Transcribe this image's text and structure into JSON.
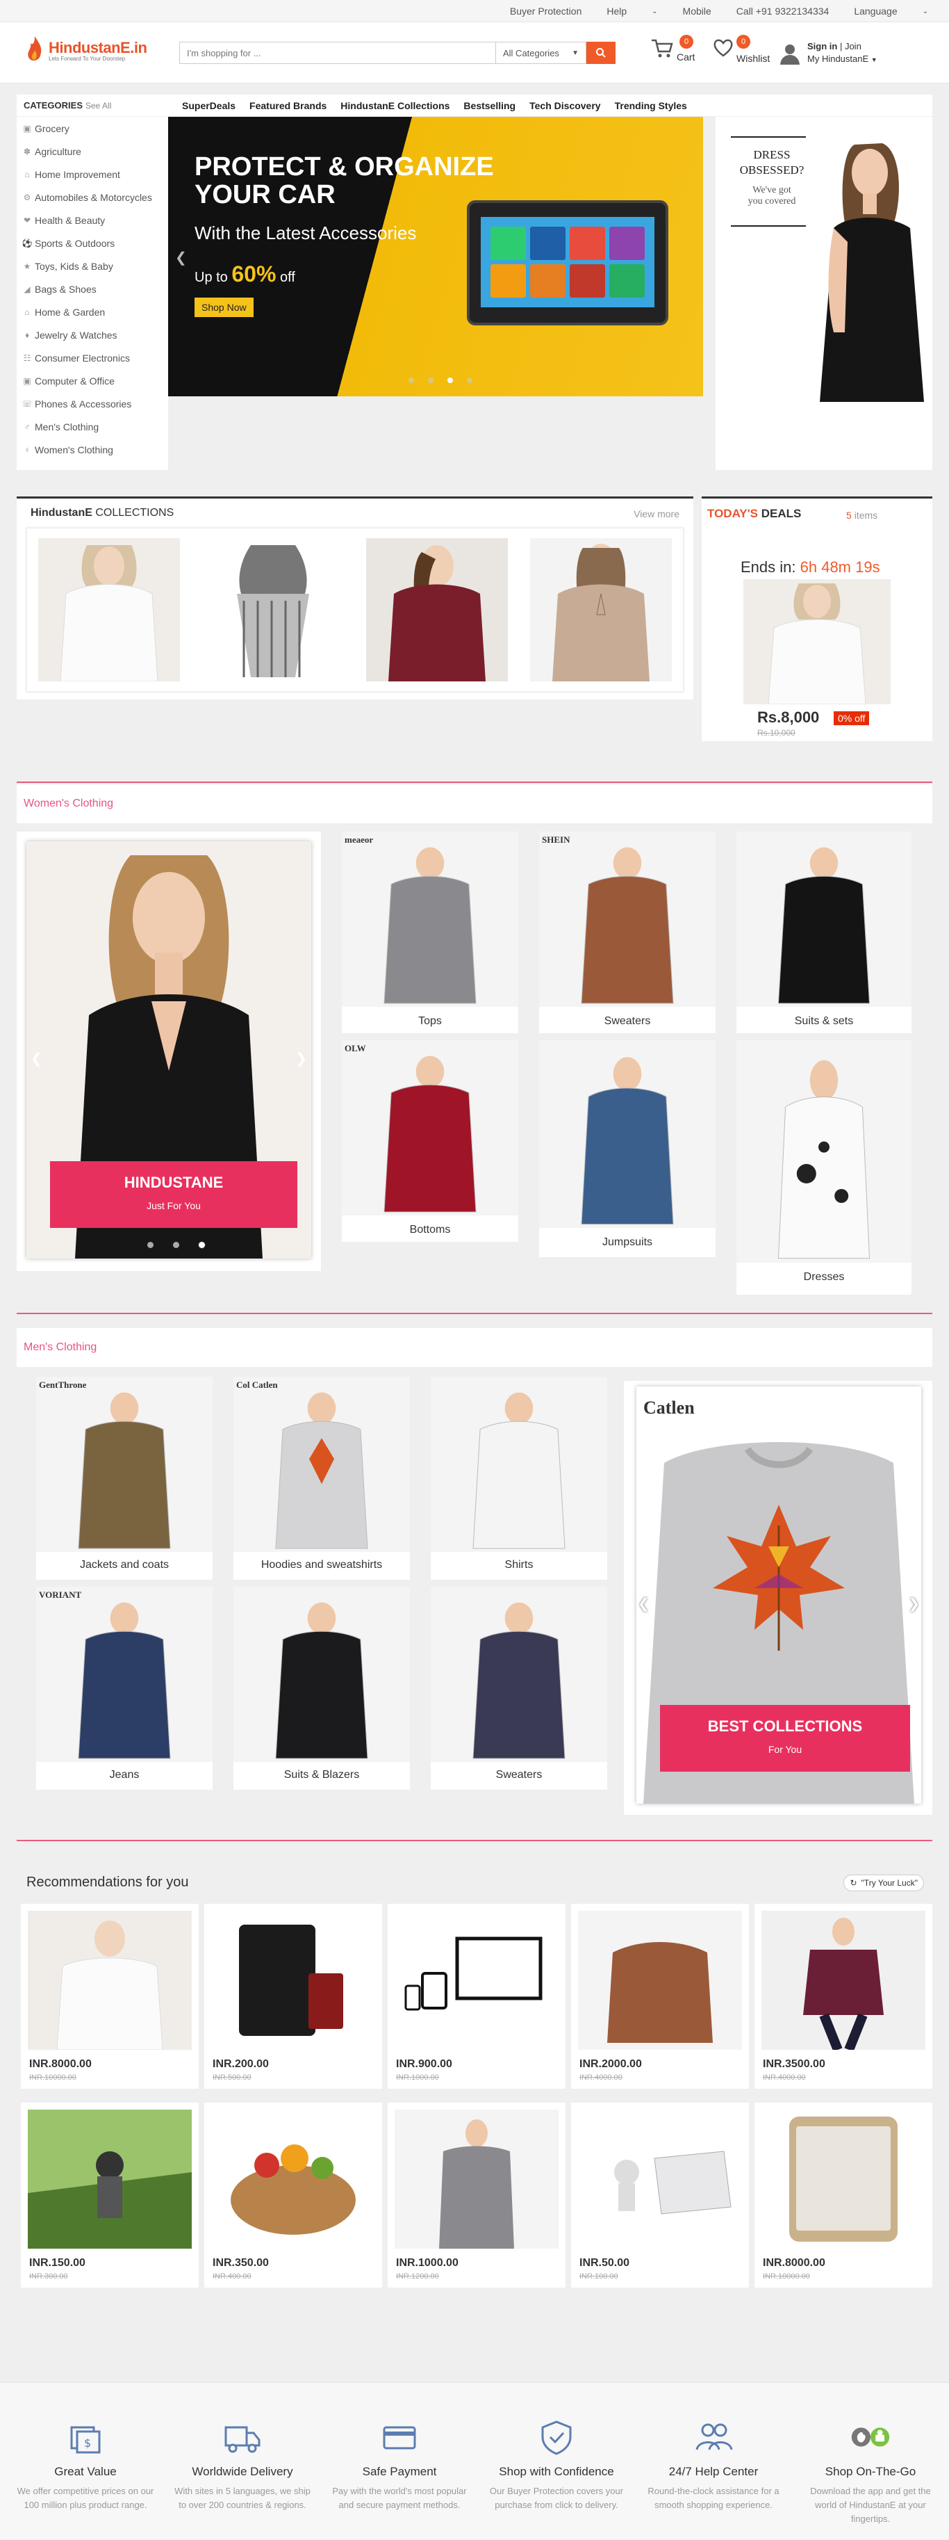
{
  "topbar": {
    "buyer_protection": "Buyer Protection",
    "help": "Help",
    "mobile": "Mobile",
    "call": "Call +91 9322134334",
    "language": "Language"
  },
  "header": {
    "logo_name": "HindustanE.in",
    "logo_tagline": "Lets Forward To Your Doorstep",
    "search_placeholder": "I'm shopping for ...",
    "search_category": "All Categories",
    "cart_label": "Cart",
    "cart_count": "0",
    "wishlist_label": "Wishlist",
    "wishlist_count": "0",
    "sign_in": "Sign in",
    "join": "Join",
    "my_account": "My HindustanE"
  },
  "categories": {
    "title": "CATEGORIES",
    "see_all": "See All",
    "items": [
      {
        "label": "Grocery"
      },
      {
        "label": "Agriculture"
      },
      {
        "label": "Home Improvement"
      },
      {
        "label": "Automobiles & Motorcycles"
      },
      {
        "label": "Health & Beauty"
      },
      {
        "label": "Sports & Outdoors"
      },
      {
        "label": "Toys, Kids & Baby"
      },
      {
        "label": "Bags & Shoes"
      },
      {
        "label": "Home & Garden"
      },
      {
        "label": "Jewelry & Watches"
      },
      {
        "label": "Consumer Electronics"
      },
      {
        "label": "Computer & Office"
      },
      {
        "label": "Phones & Accessories"
      },
      {
        "label": "Men's Clothing"
      },
      {
        "label": "Women's Clothing"
      }
    ]
  },
  "nav": {
    "items": [
      {
        "label": "SuperDeals"
      },
      {
        "label": "Featured Brands"
      },
      {
        "label": "HindustanE Collections"
      },
      {
        "label": "Bestselling"
      },
      {
        "label": "Tech Discovery"
      },
      {
        "label": "Trending Styles"
      }
    ]
  },
  "hero": {
    "line1": "PROTECT & ORGANIZE",
    "line2": "YOUR CAR",
    "line3": "With the Latest Accessories",
    "upto": "Up to",
    "percent": "60%",
    "off": "off",
    "shop_now": "Shop Now",
    "active_dot": 3
  },
  "side_ad": {
    "line1": "DRESS",
    "line2": "OBSESSED?",
    "line3": "We've got",
    "line4": "you covered"
  },
  "collections": {
    "brand": "HindustanE",
    "title": "COLLECTIONS",
    "view_more": "View more"
  },
  "deals": {
    "todays": "TODAY'S",
    "deals": "DEALS",
    "count": "5",
    "items_label": "items",
    "ends_in": "Ends in:",
    "timer": "6h 48m 19s",
    "price": "Rs.8,000",
    "off": "0% off",
    "old_price": "Rs.10,000"
  },
  "women": {
    "title": "Women's Clothing",
    "banner_title": "HINDUSTANE",
    "banner_sub": "Just For You",
    "tiles": [
      {
        "label": "Tops",
        "brand": "meaeor"
      },
      {
        "label": "Sweaters",
        "brand": "SHEIN"
      },
      {
        "label": "Suits & sets",
        "brand": ""
      },
      {
        "label": "Bottoms",
        "brand": "OLW"
      },
      {
        "label": "Jumpsuits",
        "brand": ""
      },
      {
        "label": "Dresses",
        "brand": ""
      }
    ]
  },
  "men": {
    "title": "Men's Clothing",
    "banner_title": "BEST COLLECTIONS",
    "banner_sub": "For You",
    "carousel_brand": "Catlen",
    "tiles": [
      {
        "label": "Jackets and coats",
        "brand": "GentThrone"
      },
      {
        "label": "Hoodies and sweatshirts",
        "brand": "Col Catlen"
      },
      {
        "label": "Shirts",
        "brand": ""
      },
      {
        "label": "Jeans",
        "brand": "VORIANT"
      },
      {
        "label": "Suits & Blazers",
        "brand": ""
      },
      {
        "label": "Sweaters",
        "brand": ""
      }
    ]
  },
  "recommendations": {
    "title": "Recommendations for you",
    "luck": "\"Try Your Luck\"",
    "items": [
      {
        "price": "INR.8000.00",
        "old": "INR.10000.00"
      },
      {
        "price": "INR.200.00",
        "old": "INR.500.00"
      },
      {
        "price": "INR.900.00",
        "old": "INR.1000.00"
      },
      {
        "price": "INR.2000.00",
        "old": "INR.4000.00"
      },
      {
        "price": "INR.3500.00",
        "old": "INR.4000.00"
      },
      {
        "price": "INR.150.00",
        "old": "INR.300.00"
      },
      {
        "price": "INR.350.00",
        "old": "INR.400.00"
      },
      {
        "price": "INR.1000.00",
        "old": "INR.1200.00"
      },
      {
        "price": "INR.50.00",
        "old": "INR.100.00"
      },
      {
        "price": "INR.8000.00",
        "old": "INR.10000.00"
      }
    ]
  },
  "footer": {
    "features": [
      {
        "title": "Great Value",
        "desc": "We offer competitive prices on our 100 million plus product range.",
        "icon": "money-icon"
      },
      {
        "title": "Worldwide Delivery",
        "desc": "With sites in 5 languages, we ship to over 200 countries & regions.",
        "icon": "truck-icon"
      },
      {
        "title": "Safe Payment",
        "desc": "Pay with the world's most popular and secure payment methods.",
        "icon": "card-icon"
      },
      {
        "title": "Shop with Confidence",
        "desc": "Our Buyer Protection covers your purchase from click to delivery.",
        "icon": "shield-icon"
      },
      {
        "title": "24/7 Help Center",
        "desc": "Round-the-clock assistance for a smooth shopping experience.",
        "icon": "people-icon"
      },
      {
        "title": "Shop On-The-Go",
        "desc": "Download the app and get the world of HindustanE at your fingertips.",
        "icon": "app-icon"
      }
    ]
  },
  "colors": {
    "accent": "#f05a28",
    "pink": "#e8305e",
    "section_title": "#e75480"
  }
}
